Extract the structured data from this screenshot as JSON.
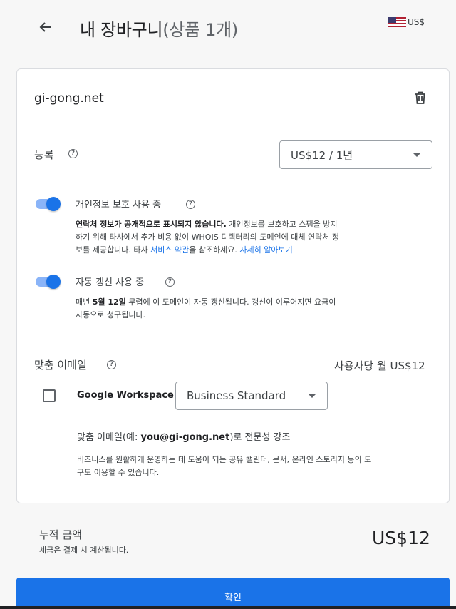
{
  "header": {
    "title": "내 장바구니",
    "count": "(상품 1개)",
    "currency": "US$",
    "back_icon": "arrow-left-icon",
    "flag_icon": "us-flag-icon"
  },
  "cart": {
    "domain": "gi-gong.net",
    "delete_icon": "trash-icon",
    "registration": {
      "label": "등록",
      "selected_term": "US$12 / 1년"
    },
    "privacy": {
      "label": "개인정보 보호 사용 중",
      "enabled": true,
      "desc_bold": "연락처 정보가 공개적으로 표시되지 않습니다.",
      "desc_line1": " 개인정보를 보호하고 스팸을 방지",
      "desc_line2": "하기 위해 타사에서 추가 비용 없이 WHOIS 디렉터리의 도메인에 대체 연락처 정",
      "desc_line3a": "보를 제공합니다. 타사 ",
      "terms_link": "서비스 약관",
      "desc_line3b": "을 참조하세요. ",
      "learn_more_link": "자세히 알아보기"
    },
    "auto_renew": {
      "label": "자동 갱신 사용 중",
      "enabled": true,
      "desc_a": "매년 ",
      "desc_date": "5월 12일",
      "desc_b": " 무렵에 이 도메인이 자동 갱신됩니다. 갱신이 이루어지면 요금이",
      "desc_line2": "자동으로 청구됩니다."
    },
    "email": {
      "label": "맞춤 이메일",
      "price": "사용자당 월 US$12",
      "product": "Google Workspace",
      "plan": "Business Standard",
      "checked": false,
      "promo_a": "맞춤 이메일(예: ",
      "promo_b": "you@gi-gong.net",
      "promo_c": ")로 전문성 강조",
      "desc_line1": "비즈니스를 원활하게 운영하는 데 도움이 되는 공유 캘린더, 문서, 온라인 스토리지 등의 도",
      "desc_line2": "구도 이용할 수 있습니다."
    }
  },
  "summary": {
    "total_label": "누적 금액",
    "tax_note": "세금은 결제 시 계산됩니다.",
    "total_amount": "US$12"
  },
  "confirm_label": "확인",
  "colors": {
    "accent": "#1a73e8",
    "toggle_track": "#8ab4f8"
  }
}
